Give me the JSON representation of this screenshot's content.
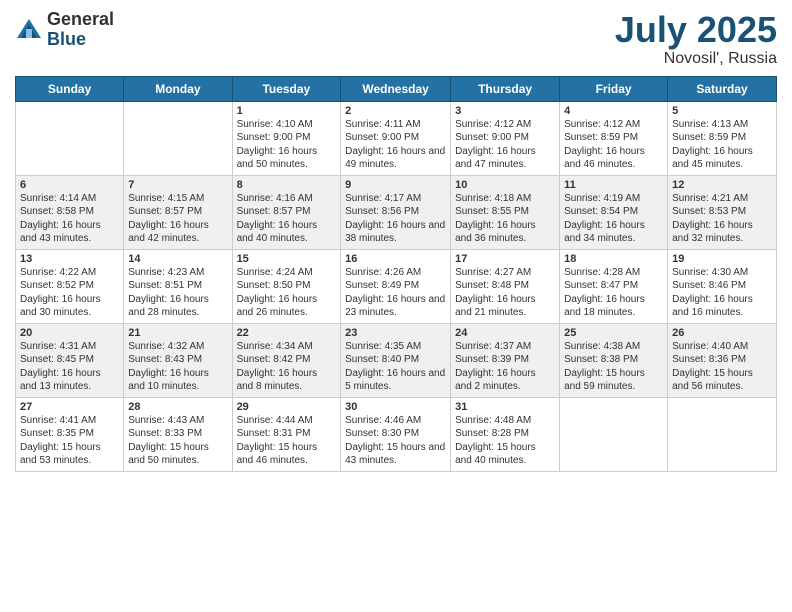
{
  "logo": {
    "general": "General",
    "blue": "Blue"
  },
  "title": {
    "month_year": "July 2025",
    "location": "Novosil', Russia"
  },
  "weekdays": [
    "Sunday",
    "Monday",
    "Tuesday",
    "Wednesday",
    "Thursday",
    "Friday",
    "Saturday"
  ],
  "weeks": [
    [
      {
        "day": "",
        "info": ""
      },
      {
        "day": "",
        "info": ""
      },
      {
        "day": "1",
        "info": "Sunrise: 4:10 AM\nSunset: 9:00 PM\nDaylight: 16 hours and 50 minutes."
      },
      {
        "day": "2",
        "info": "Sunrise: 4:11 AM\nSunset: 9:00 PM\nDaylight: 16 hours and 49 minutes."
      },
      {
        "day": "3",
        "info": "Sunrise: 4:12 AM\nSunset: 9:00 PM\nDaylight: 16 hours and 47 minutes."
      },
      {
        "day": "4",
        "info": "Sunrise: 4:12 AM\nSunset: 8:59 PM\nDaylight: 16 hours and 46 minutes."
      },
      {
        "day": "5",
        "info": "Sunrise: 4:13 AM\nSunset: 8:59 PM\nDaylight: 16 hours and 45 minutes."
      }
    ],
    [
      {
        "day": "6",
        "info": "Sunrise: 4:14 AM\nSunset: 8:58 PM\nDaylight: 16 hours and 43 minutes."
      },
      {
        "day": "7",
        "info": "Sunrise: 4:15 AM\nSunset: 8:57 PM\nDaylight: 16 hours and 42 minutes."
      },
      {
        "day": "8",
        "info": "Sunrise: 4:16 AM\nSunset: 8:57 PM\nDaylight: 16 hours and 40 minutes."
      },
      {
        "day": "9",
        "info": "Sunrise: 4:17 AM\nSunset: 8:56 PM\nDaylight: 16 hours and 38 minutes."
      },
      {
        "day": "10",
        "info": "Sunrise: 4:18 AM\nSunset: 8:55 PM\nDaylight: 16 hours and 36 minutes."
      },
      {
        "day": "11",
        "info": "Sunrise: 4:19 AM\nSunset: 8:54 PM\nDaylight: 16 hours and 34 minutes."
      },
      {
        "day": "12",
        "info": "Sunrise: 4:21 AM\nSunset: 8:53 PM\nDaylight: 16 hours and 32 minutes."
      }
    ],
    [
      {
        "day": "13",
        "info": "Sunrise: 4:22 AM\nSunset: 8:52 PM\nDaylight: 16 hours and 30 minutes."
      },
      {
        "day": "14",
        "info": "Sunrise: 4:23 AM\nSunset: 8:51 PM\nDaylight: 16 hours and 28 minutes."
      },
      {
        "day": "15",
        "info": "Sunrise: 4:24 AM\nSunset: 8:50 PM\nDaylight: 16 hours and 26 minutes."
      },
      {
        "day": "16",
        "info": "Sunrise: 4:26 AM\nSunset: 8:49 PM\nDaylight: 16 hours and 23 minutes."
      },
      {
        "day": "17",
        "info": "Sunrise: 4:27 AM\nSunset: 8:48 PM\nDaylight: 16 hours and 21 minutes."
      },
      {
        "day": "18",
        "info": "Sunrise: 4:28 AM\nSunset: 8:47 PM\nDaylight: 16 hours and 18 minutes."
      },
      {
        "day": "19",
        "info": "Sunrise: 4:30 AM\nSunset: 8:46 PM\nDaylight: 16 hours and 16 minutes."
      }
    ],
    [
      {
        "day": "20",
        "info": "Sunrise: 4:31 AM\nSunset: 8:45 PM\nDaylight: 16 hours and 13 minutes."
      },
      {
        "day": "21",
        "info": "Sunrise: 4:32 AM\nSunset: 8:43 PM\nDaylight: 16 hours and 10 minutes."
      },
      {
        "day": "22",
        "info": "Sunrise: 4:34 AM\nSunset: 8:42 PM\nDaylight: 16 hours and 8 minutes."
      },
      {
        "day": "23",
        "info": "Sunrise: 4:35 AM\nSunset: 8:40 PM\nDaylight: 16 hours and 5 minutes."
      },
      {
        "day": "24",
        "info": "Sunrise: 4:37 AM\nSunset: 8:39 PM\nDaylight: 16 hours and 2 minutes."
      },
      {
        "day": "25",
        "info": "Sunrise: 4:38 AM\nSunset: 8:38 PM\nDaylight: 15 hours and 59 minutes."
      },
      {
        "day": "26",
        "info": "Sunrise: 4:40 AM\nSunset: 8:36 PM\nDaylight: 15 hours and 56 minutes."
      }
    ],
    [
      {
        "day": "27",
        "info": "Sunrise: 4:41 AM\nSunset: 8:35 PM\nDaylight: 15 hours and 53 minutes."
      },
      {
        "day": "28",
        "info": "Sunrise: 4:43 AM\nSunset: 8:33 PM\nDaylight: 15 hours and 50 minutes."
      },
      {
        "day": "29",
        "info": "Sunrise: 4:44 AM\nSunset: 8:31 PM\nDaylight: 15 hours and 46 minutes."
      },
      {
        "day": "30",
        "info": "Sunrise: 4:46 AM\nSunset: 8:30 PM\nDaylight: 15 hours and 43 minutes."
      },
      {
        "day": "31",
        "info": "Sunrise: 4:48 AM\nSunset: 8:28 PM\nDaylight: 15 hours and 40 minutes."
      },
      {
        "day": "",
        "info": ""
      },
      {
        "day": "",
        "info": ""
      }
    ]
  ]
}
